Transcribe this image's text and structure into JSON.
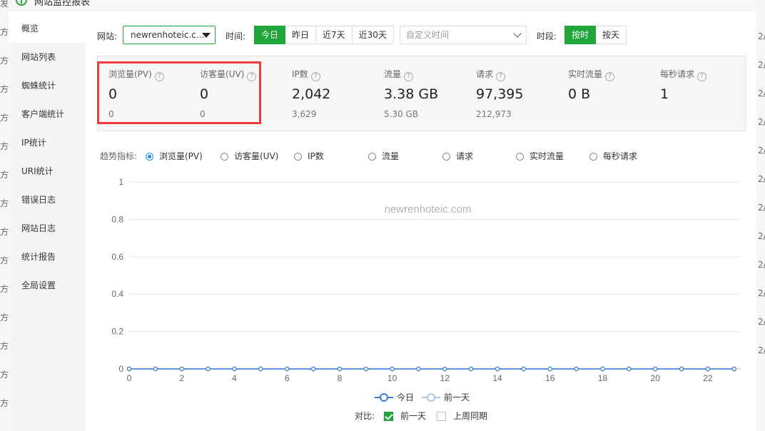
{
  "window": {
    "title": "网站监控报表"
  },
  "bg_left_text": [
    "发",
    "方",
    "方",
    "方",
    "方",
    "方",
    "方",
    "方",
    "方",
    "方",
    "方",
    "方",
    "方",
    "方",
    "方"
  ],
  "bg_right_text": [
    "2/",
    "2/",
    "2/",
    "2/",
    "2/",
    "2/",
    "2/",
    "2/",
    "2/",
    "2/",
    "2/",
    "2/"
  ],
  "sidebar": {
    "items": [
      {
        "label": "概览"
      },
      {
        "label": "网站列表"
      },
      {
        "label": "蜘蛛统计"
      },
      {
        "label": "客户端统计"
      },
      {
        "label": "IP统计"
      },
      {
        "label": "URI统计"
      },
      {
        "label": "错误日志"
      },
      {
        "label": "网站日志"
      },
      {
        "label": "统计报告"
      },
      {
        "label": "全局设置"
      }
    ]
  },
  "filters": {
    "site_label": "网站:",
    "site_value": "newrenhoteic.c...",
    "time_label": "时间:",
    "time_buttons": [
      "今日",
      "昨日",
      "近7天",
      "近30天"
    ],
    "custom_time_placeholder": "自定义时间",
    "period_label": "时段:",
    "period_buttons": [
      "按时",
      "按天"
    ]
  },
  "stats": [
    {
      "name": "浏览量(PV)",
      "value": "0",
      "prev": "0"
    },
    {
      "name": "访客量(UV)",
      "value": "0",
      "prev": "0"
    },
    {
      "name": "IP数",
      "value": "2,042",
      "prev": "3,629"
    },
    {
      "name": "流量",
      "value": "3.38 GB",
      "prev": "5.30 GB"
    },
    {
      "name": "请求",
      "value": "97,395",
      "prev": "212,973"
    },
    {
      "name": "实时流量",
      "value": "0 B",
      "prev": ""
    },
    {
      "name": "每秒请求",
      "value": "1",
      "prev": ""
    }
  ],
  "help_glyph": "?",
  "trend": {
    "label": "趋势指标:",
    "options": [
      "浏览量(PV)",
      "访客量(UV)",
      "IP数",
      "流量",
      "请求",
      "实时流量",
      "每秒请求"
    ],
    "selected": 0
  },
  "chart_data": {
    "type": "line",
    "watermark": "newrenhoteic.com",
    "x": [
      0,
      1,
      2,
      3,
      4,
      5,
      6,
      7,
      8,
      9,
      10,
      11,
      12,
      13,
      14,
      15,
      16,
      17,
      18,
      19,
      20,
      21,
      22,
      23
    ],
    "x_tick_labels": [
      "0",
      "2",
      "4",
      "6",
      "8",
      "10",
      "12",
      "14",
      "16",
      "18",
      "20",
      "22"
    ],
    "y_tick_labels": [
      "0",
      "0.2",
      "0.4",
      "0.6",
      "0.8",
      "1"
    ],
    "ylim": [
      0,
      1
    ],
    "grid": true,
    "series": [
      {
        "name": "今日",
        "color": "#3a7bd5",
        "values": [
          0,
          0,
          0,
          0,
          0,
          0,
          0,
          0,
          0,
          0,
          0,
          0,
          0,
          0,
          0,
          0,
          0,
          0,
          0,
          0,
          0,
          0,
          0,
          0
        ]
      },
      {
        "name": "前一天",
        "color": "#a9c8f0",
        "values": [
          0,
          0,
          0,
          0,
          0,
          0,
          0,
          0,
          0,
          0,
          0,
          0,
          0,
          0,
          0,
          0,
          0,
          0,
          0,
          0,
          0,
          0,
          0,
          0
        ]
      }
    ]
  },
  "compare": {
    "label": "对比:",
    "options": [
      {
        "label": "前一天",
        "checked": true
      },
      {
        "label": "上周同期",
        "checked": false
      }
    ]
  }
}
